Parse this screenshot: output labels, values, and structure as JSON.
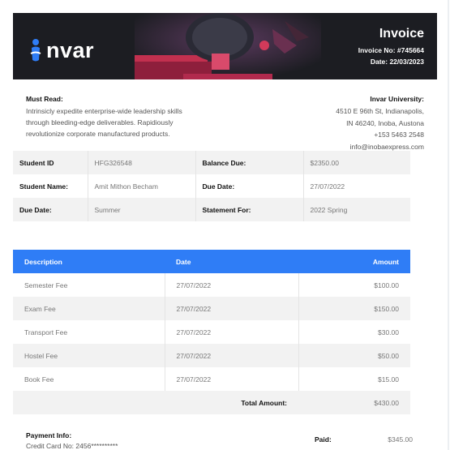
{
  "brand": {
    "name": "nvar",
    "logo_icon": "person-i-logo-icon"
  },
  "invoice": {
    "title": "Invoice",
    "number_label": "Invoice No: #745664",
    "date_label": "Date: 22/03/2023"
  },
  "must_read": {
    "title": "Must Read:",
    "lines": [
      "Intrinsicly expedite enterprise-wide leadership skills",
      "through bleeding-edge deliverables. Rapidiously",
      "revolutionize corporate manufactured products."
    ]
  },
  "university": {
    "title": "Invar University:",
    "lines": [
      "4510 E 96th St, Indianapolis,",
      "IN 46240, Inoba, Austona",
      "+153 5463 2548",
      "info@inobaexpress.com"
    ]
  },
  "student": {
    "rows": [
      [
        "Student ID",
        "HFG326548",
        "Balance Due:",
        "$2350.00"
      ],
      [
        "Student Name:",
        "Amit Mithon Becham",
        "Due Date:",
        "27/07/2022"
      ],
      [
        "Due Date:",
        "Summer",
        "Statement For:",
        "2022 Spring"
      ]
    ]
  },
  "fees": {
    "headers": [
      "Description",
      "Date",
      "Amount"
    ],
    "rows": [
      [
        "Semester Fee",
        "27/07/2022",
        "$100.00"
      ],
      [
        "Exam Fee",
        "27/07/2022",
        "$150.00"
      ],
      [
        "Transport Fee",
        "27/07/2022",
        "$30.00"
      ],
      [
        "Hostel Fee",
        "27/07/2022",
        "$50.00"
      ],
      [
        "Book Fee",
        "27/07/2022",
        "$15.00"
      ]
    ],
    "total_label": "Total Amount:",
    "total_value": "$430.00"
  },
  "payment": {
    "title": "Payment Info:",
    "card": "Credit Card No: 2456**********",
    "paid_label": "Paid:",
    "paid_value": "$345.00"
  },
  "colors": {
    "accent": "#2f7df6",
    "banner": "#1c1d22"
  }
}
